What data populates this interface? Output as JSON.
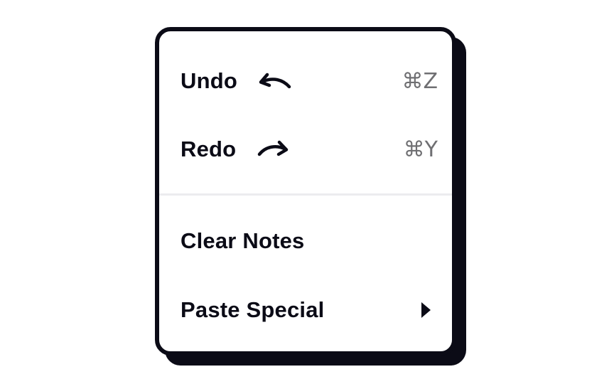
{
  "menu": {
    "items": [
      {
        "label": "Undo",
        "shortcut": "⌘Z",
        "icon": "undo-arrow-icon"
      },
      {
        "label": "Redo",
        "shortcut": "⌘Y",
        "icon": "redo-arrow-icon"
      },
      {
        "label": "Clear Notes"
      },
      {
        "label": "Paste Special",
        "icon": "submenu-triangle-icon"
      }
    ]
  },
  "colors": {
    "outline": "#0b0b16",
    "background": "#ffffff",
    "shortcut_text": "#6f6f72",
    "divider": "#ececef"
  }
}
